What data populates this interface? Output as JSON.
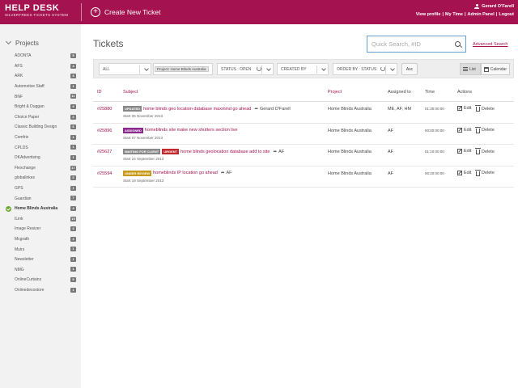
{
  "header": {
    "brand_title": "HELP DESK",
    "brand_subtitle": "SILVERTREES TICKETS SYSTEM",
    "create_label": "Create New Ticket",
    "user_name": "Gerard O'Farell",
    "links": [
      "View profile",
      "My Time",
      "Admin Panel",
      "Logout"
    ]
  },
  "sidebar": {
    "title": "Projects",
    "items": [
      {
        "label": "ADONTA",
        "count": "9"
      },
      {
        "label": "AFS",
        "count": "4"
      },
      {
        "label": "ARK",
        "count": "4"
      },
      {
        "label": "Automotive Staff",
        "count": "1"
      },
      {
        "label": "BNF",
        "count": "11"
      },
      {
        "label": "Bright & Duggan",
        "count": "4"
      },
      {
        "label": "Choice Paper",
        "count": "2"
      },
      {
        "label": "Classic Building Design",
        "count": "6"
      },
      {
        "label": "Comfrix",
        "count": "1"
      },
      {
        "label": "CPLDS",
        "count": "1"
      },
      {
        "label": "DKAdvertising",
        "count": "1"
      },
      {
        "label": "Flexchange",
        "count": "17"
      },
      {
        "label": "globallnkes",
        "count": "2"
      },
      {
        "label": "GPS",
        "count": "1"
      },
      {
        "label": "Guardian",
        "count": "7"
      },
      {
        "label": "Home Blinds Australia",
        "count": "4",
        "active": true
      },
      {
        "label": "ILink",
        "count": "15"
      },
      {
        "label": "Image Resizer",
        "count": "4"
      },
      {
        "label": "Mcgrath",
        "count": "4"
      },
      {
        "label": "Muirs",
        "count": "1"
      },
      {
        "label": "Newsletter",
        "count": "1"
      },
      {
        "label": "NMG",
        "count": "1"
      },
      {
        "label": "OnlineCurtains",
        "count": "5"
      },
      {
        "label": "Onlinedecostore",
        "count": "1"
      }
    ]
  },
  "main": {
    "title": "Tickets",
    "search_placeholder": "Quick Search, #ID",
    "advanced_search": "Advanced Search",
    "filters": {
      "all": "ALL",
      "project_tag": "Project: Home Blinds Australia",
      "status": "STATUS : OPEN",
      "created_by": "CREATED BY",
      "order_by": "ORDER BY : STATUS",
      "asc": "Asc",
      "list": "List",
      "calendar": "Calendar"
    },
    "columns": {
      "id": "ID",
      "subject": "Subject",
      "project": "Project",
      "assigned": "Assigned to",
      "time": "Time",
      "actions": "Actions"
    },
    "rows": [
      {
        "id": "#25880",
        "badge": "UPDATED",
        "badge_color": "#888888",
        "subject": "home blinds geo location database maxmind go ahead",
        "assignee": "Gerard O'Farell",
        "start": "Start 05 November 2013",
        "project": "Home Blinds Australia",
        "assigned": "ME, AF, HM",
        "time": "01:30:00:00"
      },
      {
        "id": "#25896",
        "badge": "ASSIGNED",
        "badge_color": "#8a2a8c",
        "subject": "homeblinds site make new shutters section live",
        "assignee": "",
        "start": "Start 07 November 2013",
        "project": "Home Blinds Australia",
        "assigned": "AF",
        "time": "00:00:00:00"
      },
      {
        "id": "#25627",
        "badge": "WAITING FOR CLIENT",
        "badge_color": "#888888",
        "badge2": "URGENT",
        "badge2_color": "#c0282d",
        "subject": "home blinds geolocation database add to site",
        "assignee": "AF",
        "start": "Start 24 September 2013",
        "project": "Home Blinds Australia",
        "assigned": "AF",
        "time": "01:10:00:00"
      },
      {
        "id": "#25594",
        "badge": "UNDER REVIEW",
        "badge_color": "#c89a18",
        "subject": "homeblinds IP location go ahead",
        "assignee": "AF",
        "start": "Start 19 September 2013",
        "project": "Home Blinds Australia",
        "assigned": "AF",
        "time": "00:20:00:00"
      }
    ],
    "edit_label": "Edit",
    "delete_label": "Delete"
  }
}
